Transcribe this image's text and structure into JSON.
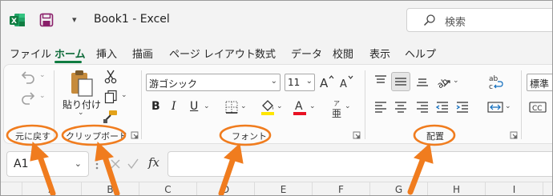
{
  "window": {
    "title": "Book1  -  Excel",
    "search_placeholder": "検索"
  },
  "tabs": [
    "ファイル",
    "ホーム",
    "挿入",
    "描画",
    "ページ レイアウト",
    "数式",
    "データ",
    "校閲",
    "表示",
    "ヘルプ"
  ],
  "active_tab": "ホーム",
  "ribbon": {
    "clipboard": {
      "paste_label": "貼り付け",
      "group_label": "クリップボード"
    },
    "undo": {
      "group_label": "元に戻す"
    },
    "font": {
      "font_name": "游ゴシック",
      "font_size": "11",
      "group_label": "フォント",
      "phonetic_glyph": "亜"
    },
    "alignment": {
      "group_label": "配置"
    },
    "number": {
      "format": "標準"
    }
  },
  "formula_bar": {
    "name_box": "A1",
    "fx_label": "fx"
  },
  "columns": [
    "A",
    "B",
    "C",
    "D",
    "E",
    "F",
    "G",
    "H",
    "I"
  ],
  "colors": {
    "excel_green": "#107c41",
    "annotation_orange": "#f07c1e",
    "font_color_red": "#e81123",
    "highlight_yellow": "#ffe600"
  }
}
